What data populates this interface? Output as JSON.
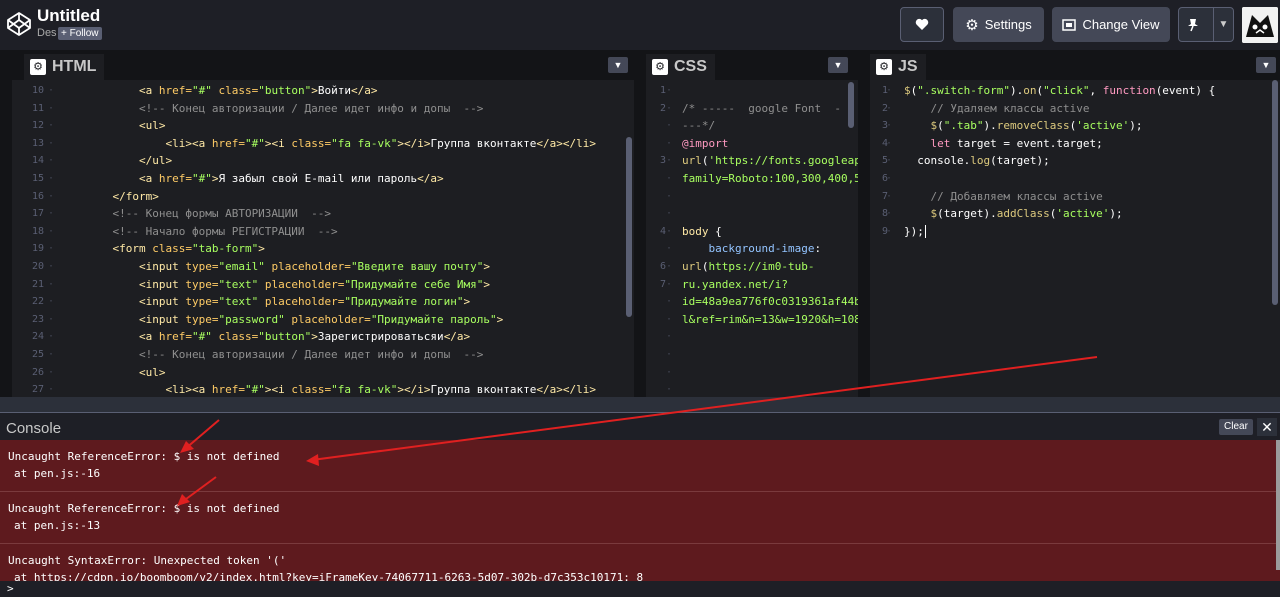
{
  "header": {
    "title": "Untitled",
    "author": "Des",
    "follow_label": "+ Follow",
    "settings_label": "Settings",
    "change_view_label": "Change View"
  },
  "html_pane": {
    "label": "HTML",
    "line_numbers": [
      "10",
      "11",
      "12",
      "13",
      "14",
      "15",
      "16",
      "17",
      "18",
      "19",
      "20",
      "21",
      "22",
      "23",
      "24",
      "25",
      "26",
      "27"
    ]
  },
  "css_pane": {
    "label": "CSS",
    "line_numbers": [
      "1",
      "2",
      "",
      "",
      "3",
      "",
      "",
      "",
      "4",
      "",
      "6",
      "7",
      "",
      "",
      "",
      "",
      "",
      ""
    ]
  },
  "js_pane": {
    "label": "JS",
    "line_numbers": [
      "1",
      "2",
      "3",
      "4",
      "5",
      "6",
      "7",
      "8",
      "9"
    ]
  },
  "console": {
    "title": "Console",
    "clear_label": "Clear",
    "close_label": "✕",
    "prompt": ">",
    "errors": [
      {
        "message": "Uncaught ReferenceError: $ is not defined",
        "location": "at pen.js:-16"
      },
      {
        "message": "Uncaught ReferenceError: $ is not defined",
        "location": "at pen.js:-13"
      },
      {
        "message": "Uncaught SyntaxError: Unexpected token '('",
        "location": "at https://cdpn.io/boomboom/v2/index.html?key=iFrameKey-74067711-6263-5d07-302b-d7c353c10171: 8"
      }
    ]
  },
  "colors": {
    "header_bg": "#1e1f26",
    "editor_bg": "#1d1e22",
    "console_error_bg": "#5e1a1e",
    "annotation_arrow": "#e02020"
  }
}
